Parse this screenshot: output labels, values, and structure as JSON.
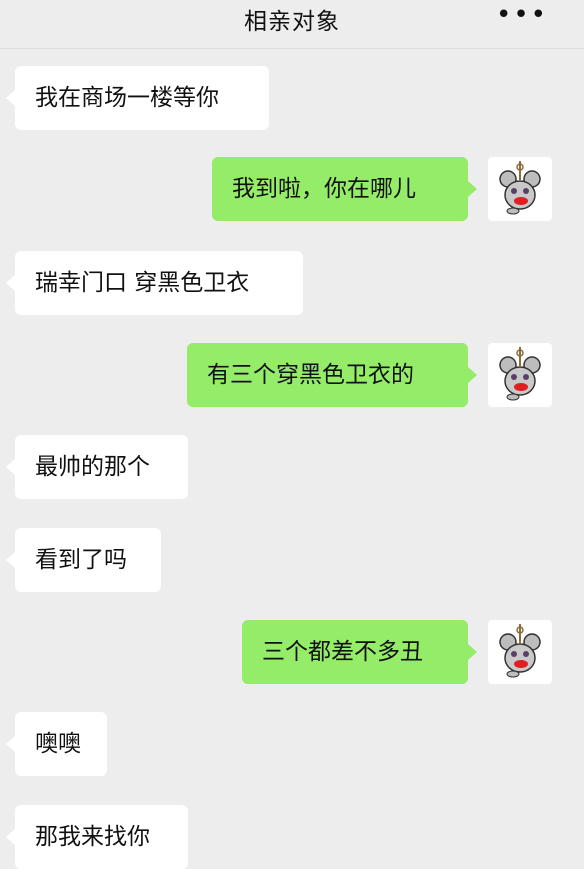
{
  "header": {
    "title": "相亲对象",
    "more_label": "•••"
  },
  "messages": [
    {
      "side": "in",
      "text": "我在商场一楼等你"
    },
    {
      "side": "out",
      "text": "我到啦，你在哪儿"
    },
    {
      "side": "in",
      "text": "瑞幸门口 穿黑色卫衣"
    },
    {
      "side": "out",
      "text": "有三个穿黑色卫衣的"
    },
    {
      "side": "in",
      "text": "最帅的那个"
    },
    {
      "side": "in",
      "text": "看到了吗"
    },
    {
      "side": "out",
      "text": "三个都差不多丑"
    },
    {
      "side": "in",
      "text": "噢噢"
    },
    {
      "side": "in",
      "text": "那我来找你"
    }
  ],
  "avatar": {
    "icon": "mouse-sticker-icon"
  }
}
